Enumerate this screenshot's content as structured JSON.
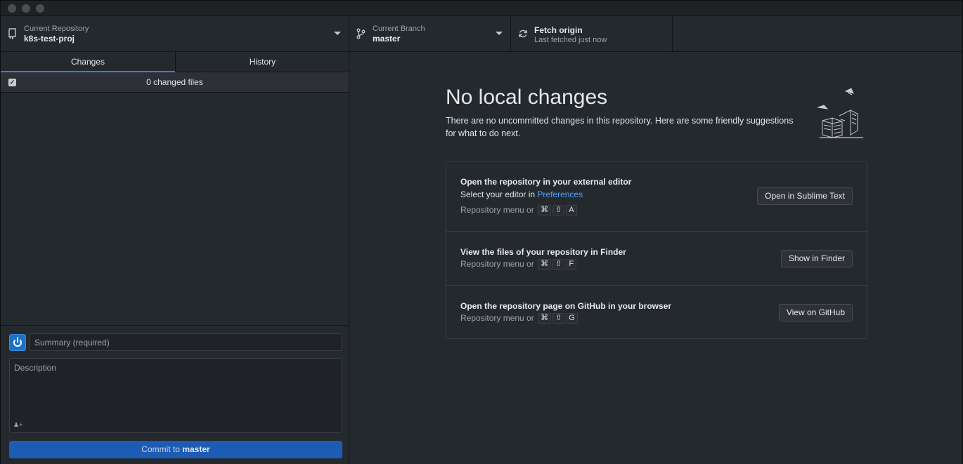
{
  "toolbar": {
    "repo": {
      "label": "Current Repository",
      "value": "k8s-test-proj"
    },
    "branch": {
      "label": "Current Branch",
      "value": "master"
    },
    "fetch": {
      "label": "Fetch origin",
      "sub": "Last fetched just now"
    }
  },
  "tabs": [
    {
      "label": "Changes",
      "active": true
    },
    {
      "label": "History",
      "active": false
    }
  ],
  "changes": {
    "count_label": "0 changed files"
  },
  "commit": {
    "summary_placeholder": "Summary (required)",
    "description_placeholder": "Description",
    "button_prefix": "Commit to",
    "button_branch": "master"
  },
  "blank": {
    "title": "No local changes",
    "description": "There are no uncommitted changes in this repository. Here are some friendly suggestions for what to do next."
  },
  "suggestions": [
    {
      "title": "Open the repository in your external editor",
      "line_prefix": "Select your editor in",
      "line_link": "Preferences",
      "shortcut_prefix": "Repository menu or",
      "keys": [
        "⌘",
        "⇧",
        "A"
      ],
      "button": "Open in Sublime Text"
    },
    {
      "title": "View the files of your repository in Finder",
      "shortcut_prefix": "Repository menu or",
      "keys": [
        "⌘",
        "⇧",
        "F"
      ],
      "button": "Show in Finder"
    },
    {
      "title": "Open the repository page on GitHub in your browser",
      "shortcut_prefix": "Repository menu or",
      "keys": [
        "⌘",
        "⇧",
        "G"
      ],
      "button": "View on GitHub"
    }
  ],
  "colors": {
    "accent": "#2f81f7",
    "commit_button": "#1d5cb4",
    "link": "#4ea1ff"
  }
}
